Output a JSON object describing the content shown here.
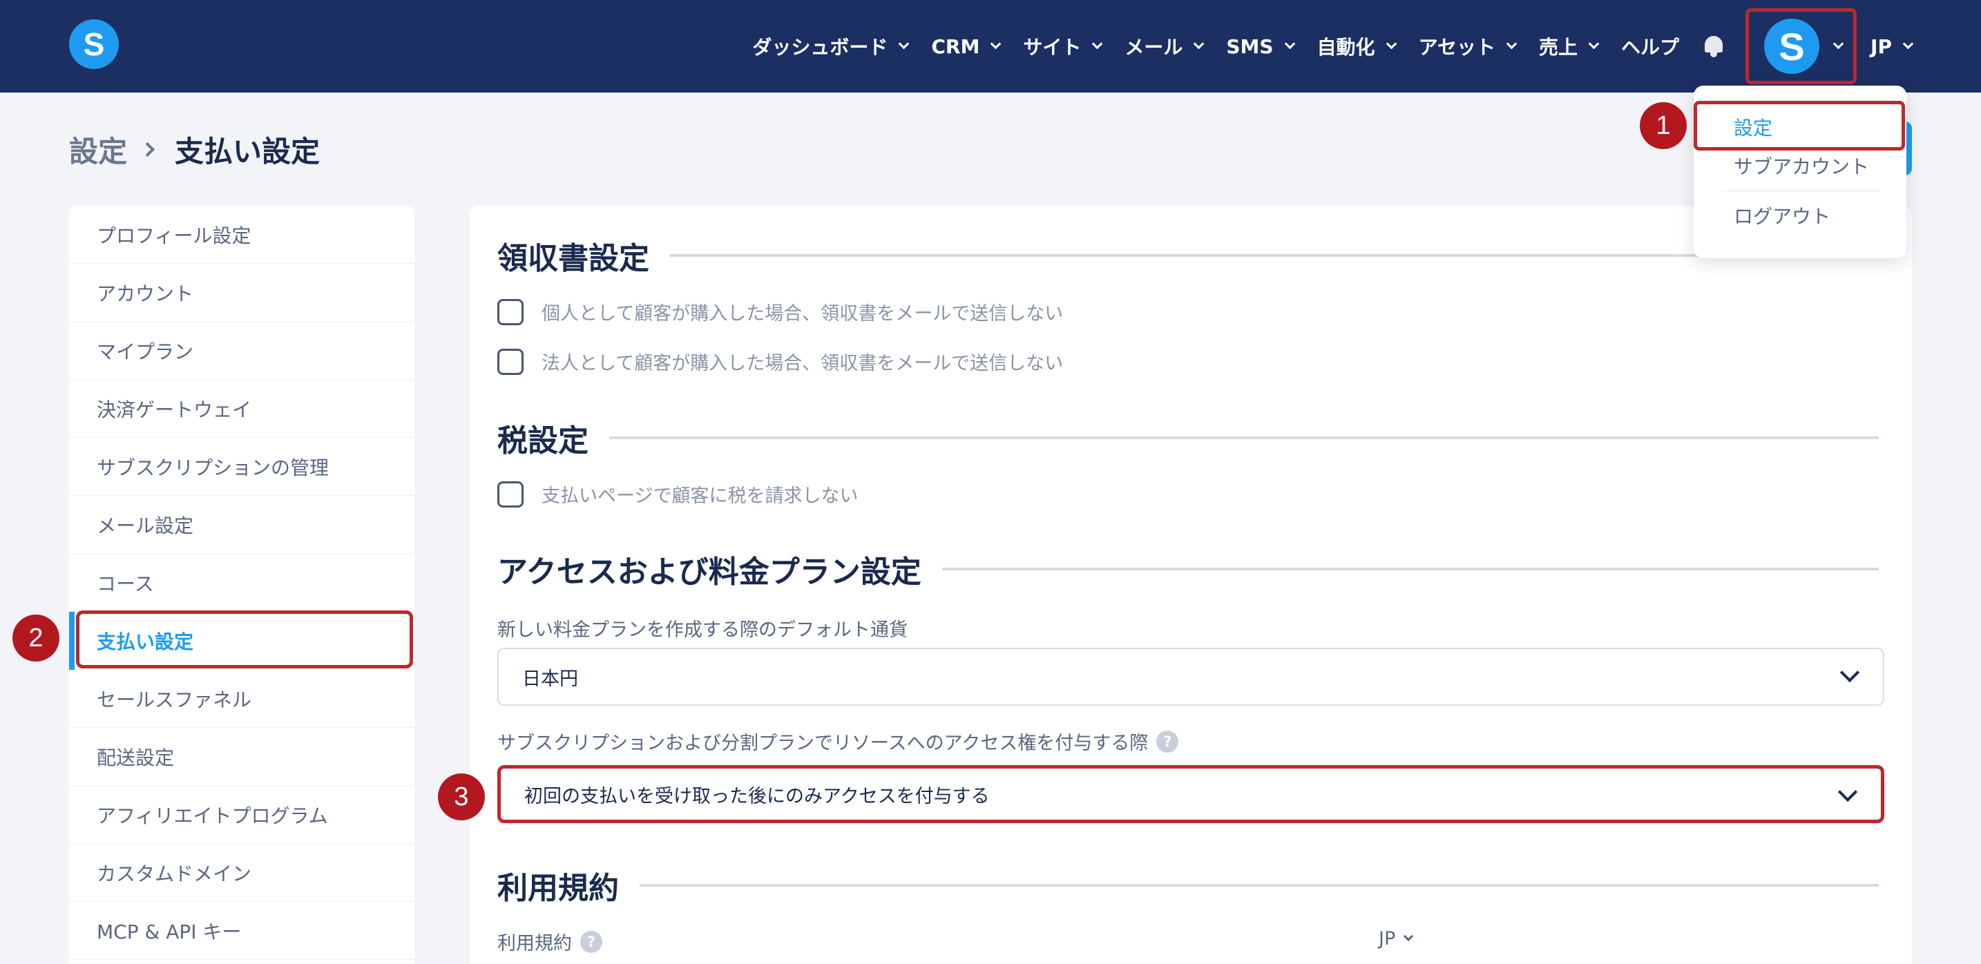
{
  "brand": {
    "logo_letter": "S",
    "avatar_letter": "S",
    "accent": "#1e9bf0",
    "nav_bg": "#1b2f63",
    "highlight": "#c0262c"
  },
  "nav": {
    "items": [
      "ダッシュボード",
      "CRM",
      "サイト",
      "メール",
      "SMS",
      "自動化",
      "アセット",
      "売上"
    ],
    "help": "ヘルプ",
    "lang": "JP"
  },
  "breadcrumb": {
    "parent": "設定",
    "current": "支払い設定"
  },
  "dropdown": {
    "items": [
      "設定",
      "サブアカウント",
      "ログアウト"
    ]
  },
  "sidebar": {
    "items": [
      "プロフィール設定",
      "アカウント",
      "マイプラン",
      "決済ゲートウェイ",
      "サブスクリプションの管理",
      "メール設定",
      "コース",
      "支払い設定",
      "セールスファネル",
      "配送設定",
      "アフィリエイトプログラム",
      "カスタムドメイン",
      "MCP & API キー"
    ],
    "active_index": 7
  },
  "receipt": {
    "title": "領収書設定",
    "options": [
      "個人として顧客が購入した場合、領収書をメールで送信しない",
      "法人として顧客が購入した場合、領収書をメールで送信しない"
    ]
  },
  "tax": {
    "title": "税設定",
    "option": "支払いページで顧客に税を請求しない"
  },
  "access": {
    "title": "アクセスおよび料金プラン設定",
    "currency_label": "新しい料金プランを作成する際のデフォルト通貨",
    "currency_value": "日本円",
    "grant_label": "サブスクリプションおよび分割プランでリソースへのアクセス権を付与する際",
    "grant_value": "初回の支払いを受け取った後にのみアクセスを付与する"
  },
  "terms": {
    "title": "利用規約",
    "label": "利用規約",
    "lang": "JP"
  },
  "help_glyph": "?",
  "markers": [
    "1",
    "2",
    "3"
  ]
}
